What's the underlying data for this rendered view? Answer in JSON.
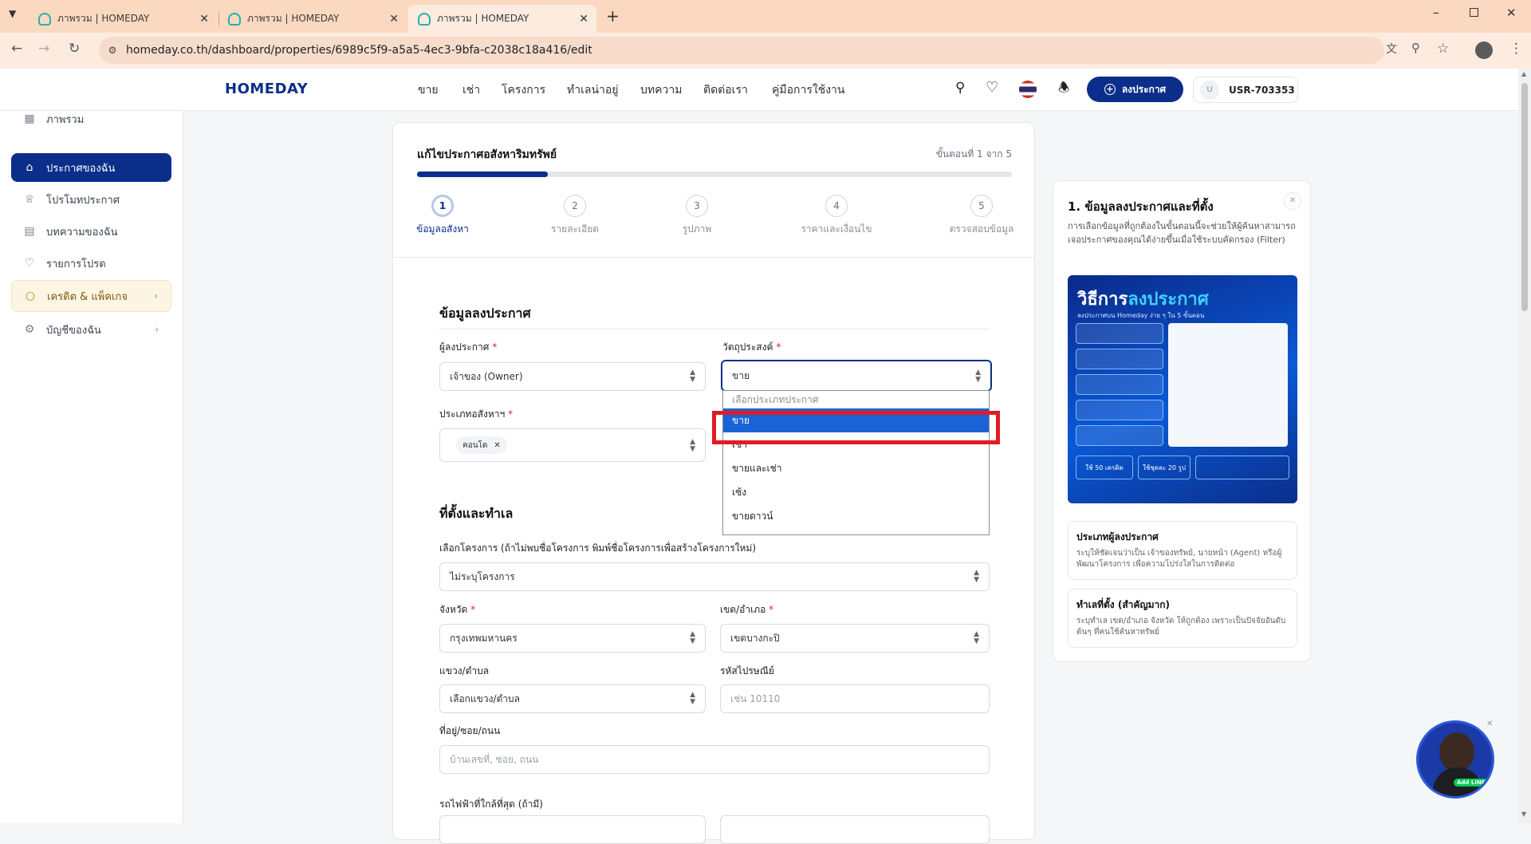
{
  "browser": {
    "tabs": [
      {
        "title": "ภาพรวม | HOMEDAY",
        "active": false
      },
      {
        "title": "ภาพรวม | HOMEDAY",
        "active": false
      },
      {
        "title": "ภาพรวม | HOMEDAY",
        "active": true
      }
    ],
    "url": "homeday.co.th/dashboard/properties/6989c5f9-a5a5-4ec3-9bfa-c2038c18a416/edit"
  },
  "header": {
    "logo": "HOMEDAY",
    "nav": [
      "ขาย",
      "เช่า",
      "โครงการ",
      "ทำเลน่าอยู่",
      "บทความ",
      "ติดต่อเรา",
      "คู่มือการใช้งาน"
    ],
    "post_button": "ลงประกาศ",
    "user_initial": "U",
    "user_id": "USR-703353"
  },
  "sidebar": {
    "items": [
      {
        "label": "ภาพรวม",
        "icon": "grid-icon"
      },
      {
        "label": "ประกาศของฉัน",
        "icon": "home-icon"
      },
      {
        "label": "โปรโมทประกาศ",
        "icon": "crown-icon"
      },
      {
        "label": "บทความของฉัน",
        "icon": "document-icon"
      },
      {
        "label": "รายการโปรด",
        "icon": "heart-icon"
      },
      {
        "label": "เครดิต & แพ็คเกจ",
        "icon": "coins-icon"
      },
      {
        "label": "บัญชีของฉัน",
        "icon": "gear-icon"
      }
    ]
  },
  "form": {
    "title": "แก้ไขประกาศอสังหาริมทรัพย์",
    "step_counter": "ขั้นตอนที่ 1 จาก 5",
    "progress": 0.22,
    "steps": [
      {
        "num": "1",
        "label": "ข้อมูลอสังหา"
      },
      {
        "num": "2",
        "label": "รายละเอียด"
      },
      {
        "num": "3",
        "label": "รูปภาพ"
      },
      {
        "num": "4",
        "label": "ราคาและเงื่อนไข"
      },
      {
        "num": "5",
        "label": "ตรวจสอบข้อมูล"
      }
    ],
    "section1_title": "ข้อมูลลงประกาศ",
    "poster_label": "ผู้ลงประกาศ",
    "poster_value": "เจ้าของ (Owner)",
    "purpose_label": "วัตถุประสงค์",
    "purpose_value": "ขาย",
    "type_label": "ประเภทอสังหาฯ",
    "type_chip": "คอนโด",
    "section2_title": "ที่ตั้งและทำเล",
    "project_label": "เลือกโครงการ (ถ้าไม่พบชื่อโครงการ พิมพ์ชื่อโครงการเพื่อสร้างโครงการใหม่)",
    "project_value": "ไม่ระบุโครงการ",
    "province_label": "จังหวัด",
    "province_value": "กรุงเทพมหานคร",
    "district_label": "เขต/อำเภอ",
    "district_value": "เขตบางกะปิ",
    "subdistrict_label": "แขวง/ตำบล",
    "subdistrict_value": "เลือกแขวง/ตำบล",
    "postcode_label": "รหัสไปรษณีย์",
    "postcode_placeholder": "เช่น 10110",
    "address_label": "ที่อยู่/ซอย/ถนน",
    "address_placeholder": "บ้านเลขที่, ซอย, ถนน",
    "train_label": "รถไฟฟ้าที่ใกล้ที่สุด (ถ้ามี)"
  },
  "dropdown": {
    "hint": "เลือกประเภทประกาศ",
    "options": [
      "ขาย",
      "เช่า",
      "ขายและเช่า",
      "เซ้ง",
      "ขายดาวน์"
    ],
    "selected": "ขาย"
  },
  "help_panel": {
    "title": "1. ข้อมูลลงประกาศและที่ตั้ง",
    "description": "การเลือกข้อมูลที่ถูกต้องในขั้นตอนนี้จะช่วยให้ผู้ค้นหาสามารถเจอประกาศของคุณได้ง่ายขึ้นเมื่อใช้ระบบคัดกรอง (Filter)",
    "banner_title_a": "วิธีการ",
    "banner_title_b": "ลงประกาศ",
    "banner_sub": "ลงประกาศบน Homeday ง่าย ๆ ใน 5 ขั้นตอน",
    "banner_badge_a": "ใช้ 50 เครดิต",
    "banner_badge_b": "ใช้ชุดละ 20 รูป",
    "box1_title": "ประเภทผู้ลงประกาศ",
    "box1_text": "ระบุให้ชัดเจนว่าเป็น เจ้าของทรัพย์, นายหน้า (Agent) หรือผู้พัฒนาโครงการ เพื่อความโปร่งใสในการติดต่อ",
    "box2_title": "ทำเลที่ตั้ง (สำคัญมาก)",
    "box2_text": "ระบุทำเล เขต/อำเภอ จังหวัด ให้ถูกต้อง เพราะเป็นปัจจัยอันดับต้นๆ ที่คนใช้ค้นหาทรัพย์"
  },
  "chat_widget": {
    "badge": "Add LINE"
  },
  "colors": {
    "brand": "#0b2e8a",
    "highlight": "#e01b24",
    "selected": "#1a63d6"
  }
}
